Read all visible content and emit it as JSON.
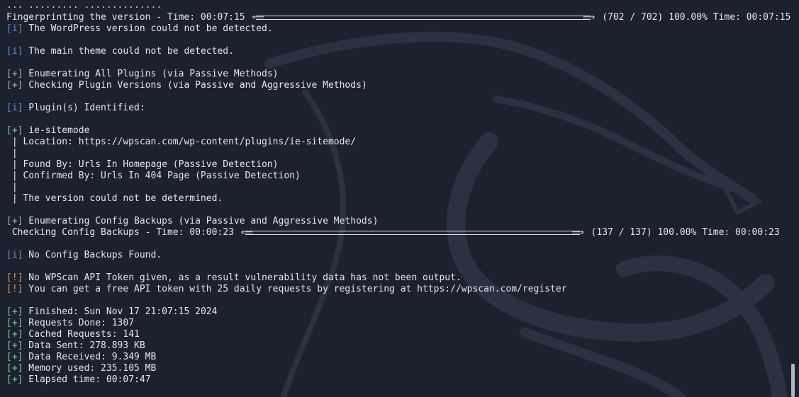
{
  "terminal": {
    "background": "#1c222d",
    "text_color": "#e3e6ea",
    "prefix_info": "[i]",
    "prefix_plus": "[+]",
    "prefix_warn": "[!]",
    "top_fragment": "             ...    .........        ..............",
    "progress1": {
      "label": "Fingerprinting the version - Time: 00:07:15 ",
      "right": " (702 / 702) 100.00% Time: 00:07:15",
      "fraction": 1.0
    },
    "progress2": {
      "label": " Checking Config Backups - Time: 00:00:23 ",
      "right": " (137 / 137) 100.00% Time: 00:00:23",
      "fraction": 1.0
    },
    "lines": {
      "wp_version": " The WordPress version could not be detected.",
      "main_theme": " The main theme could not be detected.",
      "enum_plugins": " Enumerating All Plugins (via Passive Methods)",
      "check_plugin_versions": " Checking Plugin Versions (via Passive and Aggressive Methods)",
      "plugins_identified": " Plugin(s) Identified:",
      "plugin_name": " ie-sitemode",
      "location": " | Location: https://wpscan.com/wp-content/plugins/ie-sitemode/",
      "pipe1": " |",
      "found_by": " | Found By: Urls In Homepage (Passive Detection)",
      "confirmed_by": " | Confirmed By: Urls In 404 Page (Passive Detection)",
      "pipe2": " |",
      "version_undetermined": " | The version could not be determined.",
      "enum_config": " Enumerating Config Backups (via Passive and Aggressive Methods)",
      "no_config": " No Config Backups Found.",
      "no_token": " No WPScan API Token given, as a result vulnerability data has not been output.",
      "free_token": " You can get a free API token with 25 daily requests by registering at https://wpscan.com/register",
      "finished": " Finished: Sun Nov 17 21:07:15 2024",
      "requests_done": " Requests Done: 1307",
      "cached_requests": " Cached Requests: 141",
      "data_sent": " Data Sent: 278.893 KB",
      "data_received": " Data Received: 9.349 MB",
      "memory_used": " Memory used: 235.105 MB",
      "elapsed_time": " Elapsed time: 00:07:47"
    }
  }
}
